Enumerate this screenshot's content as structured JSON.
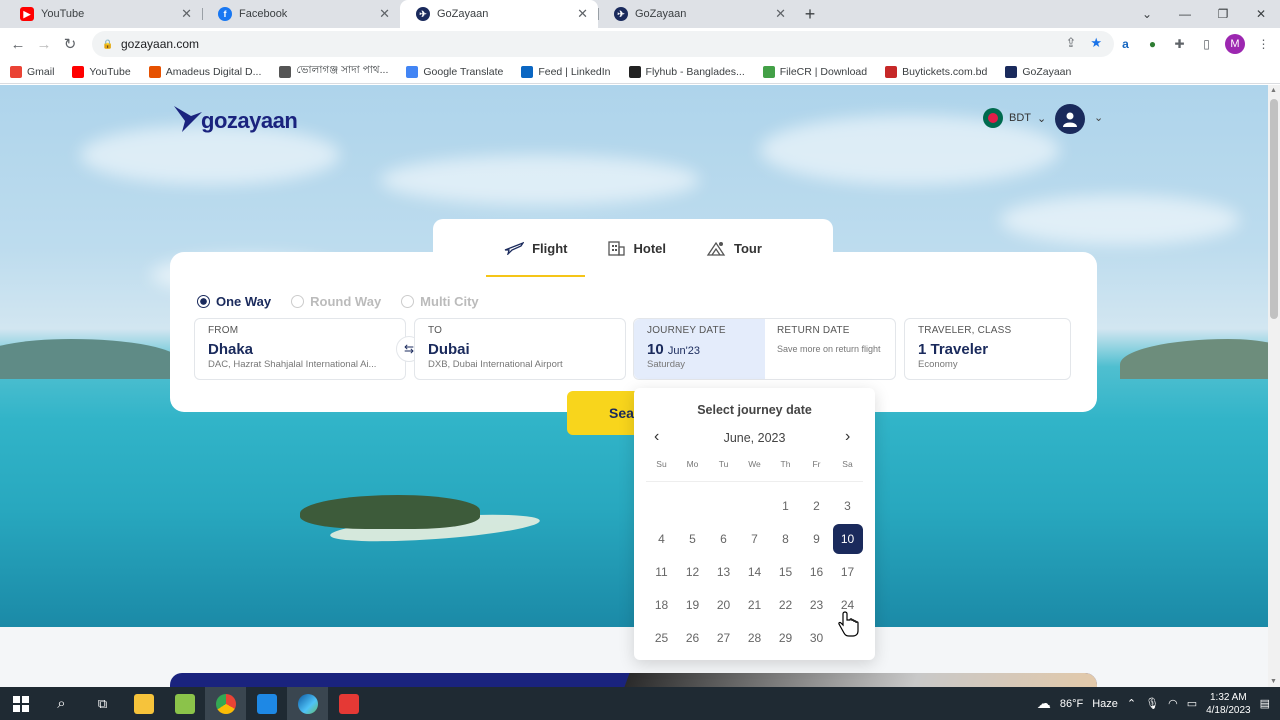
{
  "browser": {
    "tabs": [
      {
        "label": "YouTube",
        "icon": "youtube-icon",
        "color": "#ff0000",
        "active": false
      },
      {
        "label": "Facebook",
        "icon": "facebook-icon",
        "color": "#1877f2",
        "active": false
      },
      {
        "label": "GoZayaan",
        "icon": "gozayaan-icon",
        "color": "#1a2a5c",
        "active": true
      },
      {
        "label": "GoZayaan",
        "icon": "gozayaan-icon",
        "color": "#1a2a5c",
        "active": false
      }
    ],
    "url": "gozayaan.com",
    "profile_initial": "M",
    "bookmarks": [
      {
        "label": "Gmail",
        "color": "#ea4335"
      },
      {
        "label": "YouTube",
        "color": "#ff0000"
      },
      {
        "label": "Amadeus Digital D...",
        "color": "#e65100"
      },
      {
        "label": "ভোলাগঞ্জ সাদা পাথ...",
        "color": "#555555"
      },
      {
        "label": "Google Translate",
        "color": "#4285f4"
      },
      {
        "label": "Feed | LinkedIn",
        "color": "#0a66c2"
      },
      {
        "label": "Flyhub - Banglades...",
        "color": "#222222"
      },
      {
        "label": "FileCR | Download",
        "color": "#43a047"
      },
      {
        "label": "Buytickets.com.bd",
        "color": "#c62828"
      },
      {
        "label": "GoZayaan",
        "color": "#1a2a5c"
      }
    ]
  },
  "site": {
    "logo_text": "gozayaan",
    "currency": "BDT",
    "product_tabs": [
      {
        "label": "Flight",
        "icon": "airplane-icon",
        "active": true
      },
      {
        "label": "Hotel",
        "icon": "hotel-icon",
        "active": false
      },
      {
        "label": "Tour",
        "icon": "tour-icon",
        "active": false
      }
    ],
    "trip_types": [
      {
        "label": "One Way",
        "selected": true
      },
      {
        "label": "Round Way",
        "selected": false
      },
      {
        "label": "Multi City",
        "selected": false
      }
    ],
    "from": {
      "label": "FROM",
      "city": "Dhaka",
      "airport": "DAC, Hazrat Shahjalal International Ai..."
    },
    "to": {
      "label": "TO",
      "city": "Dubai",
      "airport": "DXB, Dubai International Airport"
    },
    "journey_date": {
      "label": "JOURNEY DATE",
      "day": "10",
      "month_year": "Jun'23",
      "weekday": "Saturday"
    },
    "return_date": {
      "label": "RETURN DATE",
      "note": "Save more on return flight"
    },
    "traveler": {
      "label": "TRAVELER, CLASS",
      "value": "1 Traveler",
      "class": "Economy"
    },
    "search_label": "Sea",
    "calendar": {
      "title": "Select journey date",
      "month": "June, 2023",
      "weekdays": [
        "Su",
        "Mo",
        "Tu",
        "We",
        "Th",
        "Fr",
        "Sa"
      ],
      "days": [
        "",
        "",
        "",
        "",
        "1",
        "2",
        "3",
        "4",
        "5",
        "6",
        "7",
        "8",
        "9",
        "10",
        "11",
        "12",
        "13",
        "14",
        "15",
        "16",
        "17",
        "18",
        "19",
        "20",
        "21",
        "22",
        "23",
        "24",
        "25",
        "26",
        "27",
        "28",
        "29",
        "30",
        ""
      ],
      "selected": "10"
    }
  },
  "taskbar": {
    "weather_temp": "86°F",
    "weather_desc": "Haze",
    "time": "1:32 AM",
    "date": "4/18/2023"
  },
  "colors": {
    "brand": "#1a2a5c",
    "accent": "#f8d51c"
  }
}
